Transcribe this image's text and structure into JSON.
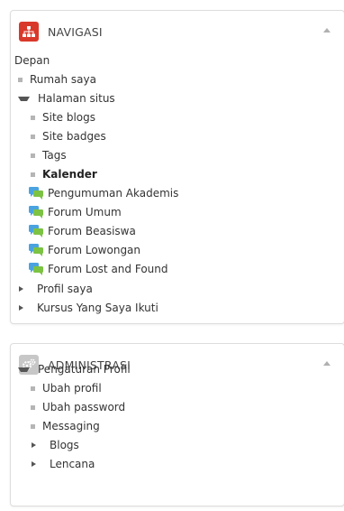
{
  "colors": {
    "nav_icon_bg": "#d9392b",
    "admin_icon_bg": "#c7c7c7",
    "forum_icon_blue": "#4aa3df",
    "forum_icon_green": "#7cc243"
  },
  "navigation": {
    "title": "NAVIGASI",
    "icon": "sitemap-icon",
    "home": "Depan",
    "items": {
      "rumah_saya": "Rumah saya",
      "halaman_situs": "Halaman situs",
      "site_blogs": "Site blogs",
      "site_badges": "Site badges",
      "tags": "Tags",
      "kalender": "Kalender",
      "pengumuman": "Pengumuman Akademis",
      "forum_umum": "Forum Umum",
      "forum_beasiswa": "Forum Beasiswa",
      "forum_lowongan": "Forum Lowongan",
      "forum_lost_found": "Forum Lost and Found",
      "profil_saya": "Profil saya",
      "kursus": "Kursus Yang Saya Ikuti"
    }
  },
  "administration": {
    "title": "ADMINISTRASI",
    "icon": "gears-icon",
    "items": {
      "pengaturan_profil": "Pengaturan Profil",
      "ubah_profil": "Ubah profil",
      "ubah_password": "Ubah password",
      "messaging": "Messaging",
      "blogs": "Blogs",
      "lencana": "Lencana"
    }
  }
}
